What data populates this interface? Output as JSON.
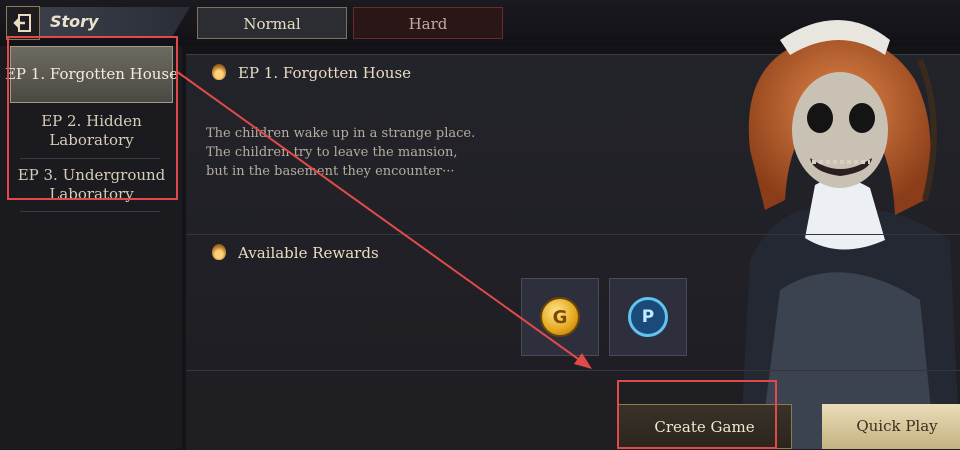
{
  "header": {
    "back_icon": "exit-icon",
    "story_label": "Story",
    "mode_normal": "Normal",
    "mode_hard": "Hard"
  },
  "sidebar": {
    "items": [
      {
        "label": "EP 1. Forgotten House",
        "selected": true
      },
      {
        "label": "EP 2. Hidden Laboratory",
        "selected": false
      },
      {
        "label": "EP 3. Underground Laboratory",
        "selected": false
      }
    ]
  },
  "episode": {
    "title": "EP 1. Forgotten House",
    "description": [
      "The children wake up in a strange place.",
      "The children try to leave the mansion,",
      "but in the basement they encounter···"
    ]
  },
  "rewards": {
    "title": "Available Rewards",
    "items": [
      {
        "icon": "gold-coin-icon",
        "glyph": "G"
      },
      {
        "icon": "point-coin-icon",
        "glyph": "P"
      }
    ]
  },
  "actions": {
    "create_game": "Create Game",
    "quick_play": "Quick Play"
  },
  "colors": {
    "highlight_red": "#e04a4a",
    "accent_gold": "#c9b27c"
  }
}
